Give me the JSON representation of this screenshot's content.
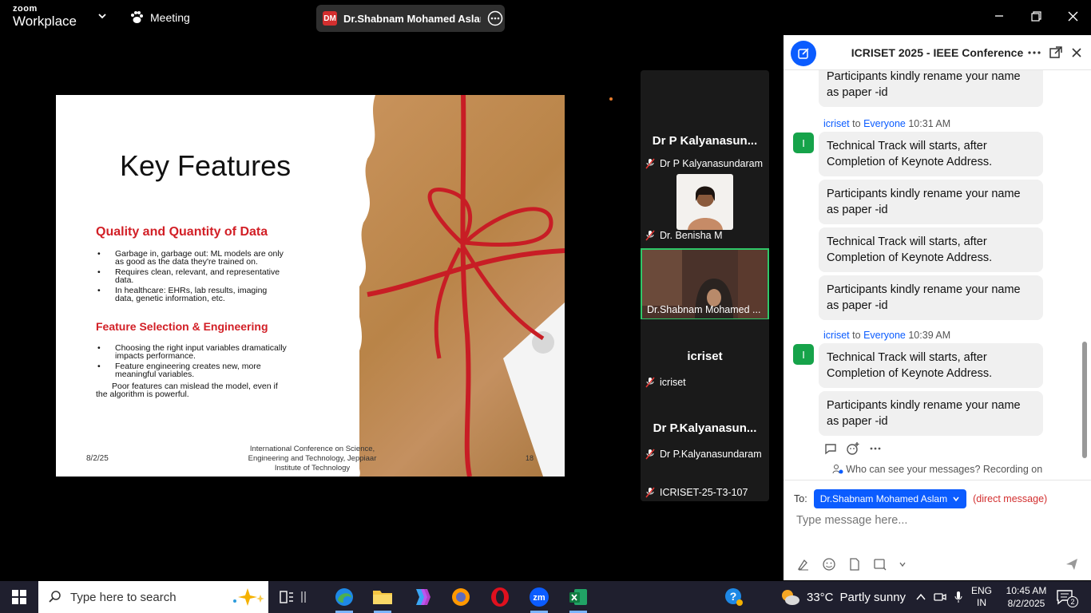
{
  "titlebar": {
    "brand_top": "zoom",
    "brand_bottom": "Workplace",
    "meeting_label": "Meeting",
    "share_initials": "DM",
    "share_name": "Dr.Shabnam Mohamed Aslam's screen"
  },
  "slide": {
    "title": "Key Features",
    "section1_heading": "Quality and Quantity of Data",
    "section1_bullets": [
      "Garbage in, garbage out: ML models are only as good as the data they're trained on.",
      "Requires clean, relevant, and representative data.",
      "In healthcare: EHRs, lab results, imaging data, genetic information, etc."
    ],
    "section2_heading": "Feature Selection & Engineering",
    "section2_bullets": [
      "Choosing the right input variables dramatically impacts performance.",
      "Feature engineering creates new, more meaningful variables."
    ],
    "section2_note": "Poor features can mislead the model, even if the algorithm is powerful.",
    "date": "8/2/25",
    "footer": "International Conference on Science, Engineering and Technology, Jeppiaar Institute of Technology",
    "page": "18"
  },
  "participants": [
    {
      "big_name": "Dr P Kalyanasun...",
      "label": "Dr P Kalyanasundaram",
      "video": false
    },
    {
      "big_name": "",
      "label": "Dr. Benisha M",
      "video": true
    },
    {
      "big_name": "",
      "label": "Dr.Shabnam Mohamed ...",
      "video": true,
      "active": true
    },
    {
      "big_name": "icriset",
      "label": "icriset",
      "video": false
    },
    {
      "big_name": "Dr P.Kalyanasun...",
      "label": "Dr P.Kalyanasundaram",
      "video": false
    },
    {
      "big_name": "",
      "label": "ICRISET-25-T3-107",
      "video": false
    }
  ],
  "chat": {
    "title": "ICRISET 2025 - IEEE Conference",
    "messages": [
      "Participants kindly rename your name as paper -id",
      "Technical Track will starts, after Completion of Keynote Address.",
      "Participants kindly rename your name as paper -id",
      "Technical Track will starts, after Completion of Keynote Address.",
      "Participants kindly rename your name as paper -id",
      "Technical Track will starts, after Completion of Keynote Address.",
      "Participants kindly rename your name as paper -id"
    ],
    "sender1": {
      "name": "icriset",
      "to": "to",
      "audience": "Everyone",
      "time": "10:31 AM",
      "initial": "I"
    },
    "sender2": {
      "name": "icriset",
      "to": "to",
      "audience": "Everyone",
      "time": "10:39 AM",
      "initial": "I"
    },
    "privacy_text": "Who can see your messages? Recording on",
    "to_label": "To:",
    "recipient": "Dr.Shabnam Mohamed Aslam",
    "direct_label": "(direct message)",
    "input_placeholder": "Type message here..."
  },
  "taskbar": {
    "search_placeholder": "Type here to search",
    "weather_temp": "33°C",
    "weather_desc": "Partly sunny",
    "lang_line1": "ENG",
    "lang_line2": "IN",
    "time": "10:45 AM",
    "date": "8/2/2025",
    "notif_count": "2"
  },
  "colors": {
    "accent_blue": "#0b5cff",
    "active_tile_border": "#2fc768",
    "slide_heading_red": "#d21f26"
  }
}
